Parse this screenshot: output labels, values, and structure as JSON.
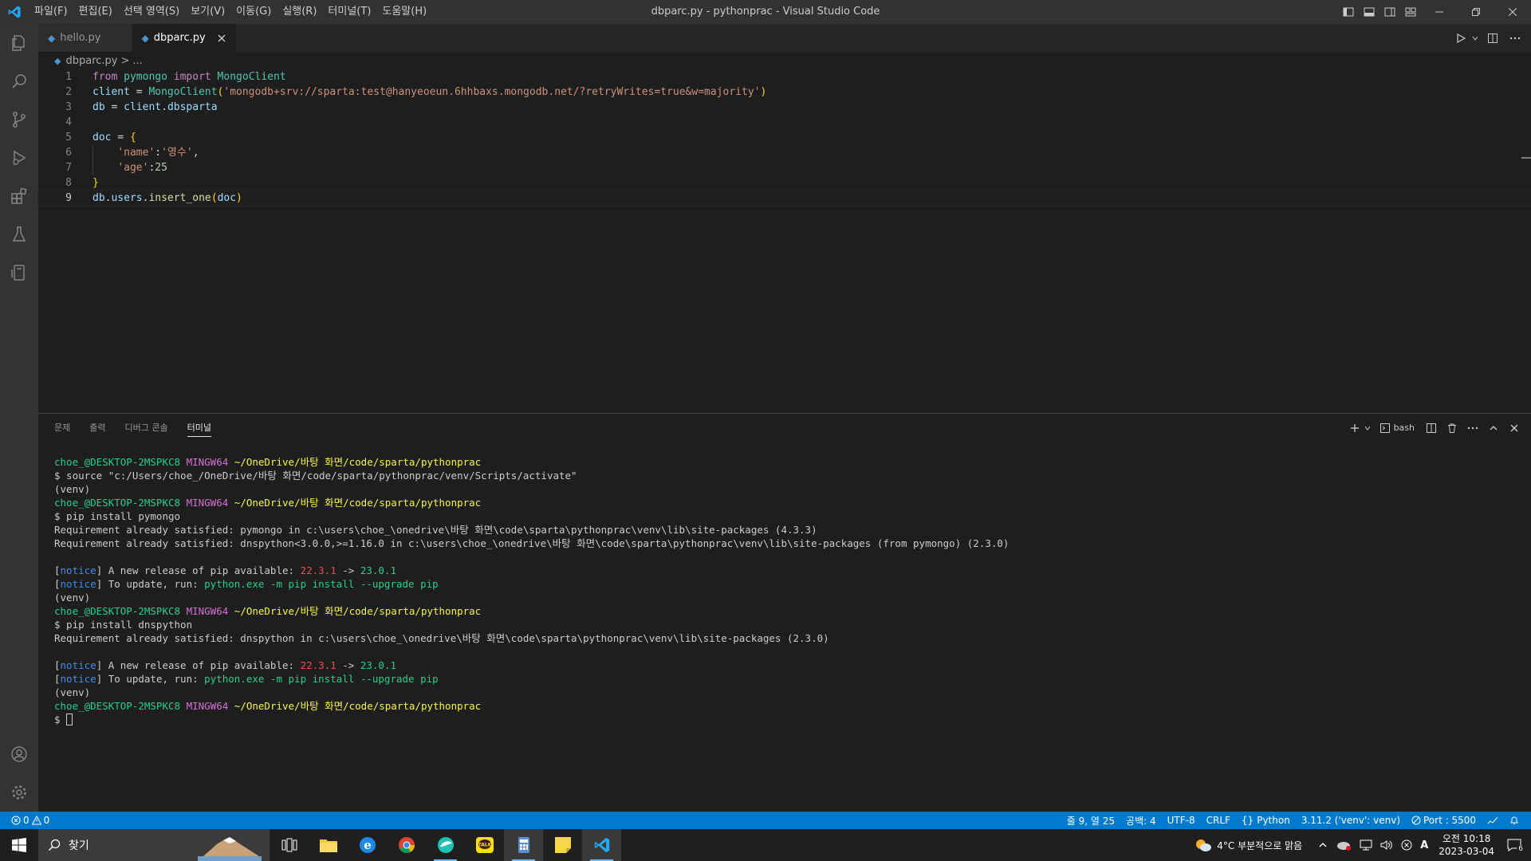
{
  "window": {
    "title": "dbparc.py - pythonprac - Visual Studio Code"
  },
  "menu": [
    "파일(F)",
    "편집(E)",
    "선택 영역(S)",
    "보기(V)",
    "이동(G)",
    "실행(R)",
    "터미널(T)",
    "도움말(H)"
  ],
  "tabs": [
    {
      "label": "hello.py",
      "active": false
    },
    {
      "label": "dbparc.py",
      "active": true
    }
  ],
  "breadcrumb": {
    "file": "dbparc.py",
    "separator": ">",
    "rest": "..."
  },
  "editor": {
    "line_numbers": [
      "1",
      "2",
      "3",
      "4",
      "5",
      "6",
      "7",
      "8",
      "9"
    ],
    "current_line": 9,
    "lines": [
      [
        {
          "t": "from",
          "c": "kw"
        },
        {
          "t": " pymongo ",
          "c": "cl"
        },
        {
          "t": "import",
          "c": "kw"
        },
        {
          "t": " MongoClient",
          "c": "cl"
        }
      ],
      [
        {
          "t": "client",
          "c": "vr"
        },
        {
          "t": " = ",
          "c": ""
        },
        {
          "t": "MongoClient",
          "c": "cl"
        },
        {
          "t": "(",
          "c": "br1"
        },
        {
          "t": "'mongodb+srv://sparta:test@hanyeoeun.6hhbaxs.mongodb.net/?retryWrites=true&w=majority'",
          "c": "st"
        },
        {
          "t": ")",
          "c": "br1"
        }
      ],
      [
        {
          "t": "db",
          "c": "vr"
        },
        {
          "t": " = ",
          "c": ""
        },
        {
          "t": "client",
          "c": "vr"
        },
        {
          "t": ".",
          "c": ""
        },
        {
          "t": "dbsparta",
          "c": "vr"
        }
      ],
      [],
      [
        {
          "t": "doc",
          "c": "vr"
        },
        {
          "t": " = ",
          "c": ""
        },
        {
          "t": "{",
          "c": "br1"
        }
      ],
      [
        {
          "t": "    ",
          "c": ""
        },
        {
          "t": "'name'",
          "c": "st"
        },
        {
          "t": ":",
          "c": ""
        },
        {
          "t": "'영수'",
          "c": "st"
        },
        {
          "t": ",",
          "c": ""
        }
      ],
      [
        {
          "t": "    ",
          "c": ""
        },
        {
          "t": "'age'",
          "c": "st"
        },
        {
          "t": ":",
          "c": ""
        },
        {
          "t": "25",
          "c": "nm"
        }
      ],
      [
        {
          "t": "}",
          "c": "br1"
        }
      ],
      [
        {
          "t": "db",
          "c": "vr"
        },
        {
          "t": ".",
          "c": ""
        },
        {
          "t": "users",
          "c": "vr"
        },
        {
          "t": ".",
          "c": ""
        },
        {
          "t": "insert_one",
          "c": "fn"
        },
        {
          "t": "(",
          "c": "br1"
        },
        {
          "t": "doc",
          "c": "vr"
        },
        {
          "t": ")",
          "c": "br1"
        }
      ]
    ]
  },
  "panel": {
    "tabs": [
      {
        "label": "문제",
        "active": false
      },
      {
        "label": "출력",
        "active": false
      },
      {
        "label": "디버그 콘솔",
        "active": false
      },
      {
        "label": "터미널",
        "active": true
      }
    ],
    "shell_label": "bash"
  },
  "terminal": {
    "lines": [
      [
        {
          "t": "choe_@DESKTOP-2MSPKC8 ",
          "c": "t-user"
        },
        {
          "t": "MINGW64 ",
          "c": "t-host"
        },
        {
          "t": "~/OneDrive/바탕 화면/code/sparta/pythonprac",
          "c": "t-path"
        }
      ],
      [
        {
          "t": "$ source \"c:/Users/choe_/OneDrive/바탕 화면/code/sparta/pythonprac/venv/Scripts/activate\"",
          "c": ""
        }
      ],
      [
        {
          "t": "(venv)",
          "c": ""
        }
      ],
      [
        {
          "t": "choe_@DESKTOP-2MSPKC8 ",
          "c": "t-user"
        },
        {
          "t": "MINGW64 ",
          "c": "t-host"
        },
        {
          "t": "~/OneDrive/바탕 화면/code/sparta/pythonprac",
          "c": "t-path"
        }
      ],
      [
        {
          "t": "$ pip install pymongo",
          "c": ""
        }
      ],
      [
        {
          "t": "Requirement already satisfied: pymongo in c:\\users\\choe_\\onedrive\\바탕 화면\\code\\sparta\\pythonprac\\venv\\lib\\site-packages (4.3.3)",
          "c": ""
        }
      ],
      [
        {
          "t": "Requirement already satisfied: dnspython<3.0.0,>=1.16.0 in c:\\users\\choe_\\onedrive\\바탕 화면\\code\\sparta\\pythonprac\\venv\\lib\\site-packages (from pymongo) (2.3.0)",
          "c": ""
        }
      ],
      [],
      [
        {
          "t": "[",
          "c": ""
        },
        {
          "t": "notice",
          "c": "t-notice"
        },
        {
          "t": "] A new release of pip available: ",
          "c": ""
        },
        {
          "t": "22.3.1",
          "c": "t-red"
        },
        {
          "t": " -> ",
          "c": ""
        },
        {
          "t": "23.0.1",
          "c": "t-green"
        }
      ],
      [
        {
          "t": "[",
          "c": ""
        },
        {
          "t": "notice",
          "c": "t-notice"
        },
        {
          "t": "] To update, run: ",
          "c": ""
        },
        {
          "t": "python.exe -m pip install --upgrade pip",
          "c": "t-green"
        }
      ],
      [
        {
          "t": "(venv)",
          "c": ""
        }
      ],
      [
        {
          "t": "choe_@DESKTOP-2MSPKC8 ",
          "c": "t-user"
        },
        {
          "t": "MINGW64 ",
          "c": "t-host"
        },
        {
          "t": "~/OneDrive/바탕 화면/code/sparta/pythonprac",
          "c": "t-path"
        }
      ],
      [
        {
          "t": "$ pip install dnspython",
          "c": ""
        }
      ],
      [
        {
          "t": "Requirement already satisfied: dnspython in c:\\users\\choe_\\onedrive\\바탕 화면\\code\\sparta\\pythonprac\\venv\\lib\\site-packages (2.3.0)",
          "c": ""
        }
      ],
      [],
      [
        {
          "t": "[",
          "c": ""
        },
        {
          "t": "notice",
          "c": "t-notice"
        },
        {
          "t": "] A new release of pip available: ",
          "c": ""
        },
        {
          "t": "22.3.1",
          "c": "t-red"
        },
        {
          "t": " -> ",
          "c": ""
        },
        {
          "t": "23.0.1",
          "c": "t-green"
        }
      ],
      [
        {
          "t": "[",
          "c": ""
        },
        {
          "t": "notice",
          "c": "t-notice"
        },
        {
          "t": "] To update, run: ",
          "c": ""
        },
        {
          "t": "python.exe -m pip install --upgrade pip",
          "c": "t-green"
        }
      ],
      [
        {
          "t": "(venv)",
          "c": ""
        }
      ],
      [
        {
          "t": "choe_@DESKTOP-2MSPKC8 ",
          "c": "t-user"
        },
        {
          "t": "MINGW64 ",
          "c": "t-host"
        },
        {
          "t": "~/OneDrive/바탕 화면/code/sparta/pythonprac",
          "c": "t-path"
        }
      ],
      [
        {
          "t": "$ ",
          "c": ""
        }
      ]
    ]
  },
  "statusbar": {
    "errors": "0",
    "warnings": "0",
    "position": "줄 9, 열 25",
    "indent": "공백: 4",
    "encoding": "UTF-8",
    "eol": "CRLF",
    "language": "Python",
    "interpreter": "3.11.2 ('venv': venv)",
    "port": "Port : 5500"
  },
  "taskbar": {
    "search_label": "찾기",
    "weather": "4°C  부분적으로 맑음",
    "time": "오전 10:18",
    "date": "2023-03-04",
    "ime": "A",
    "notification_count": "6"
  },
  "colors": {
    "accent": "#007acc",
    "editor_bg": "#1e1e1e",
    "titlebar_bg": "#323233",
    "activitybar_bg": "#333333"
  }
}
